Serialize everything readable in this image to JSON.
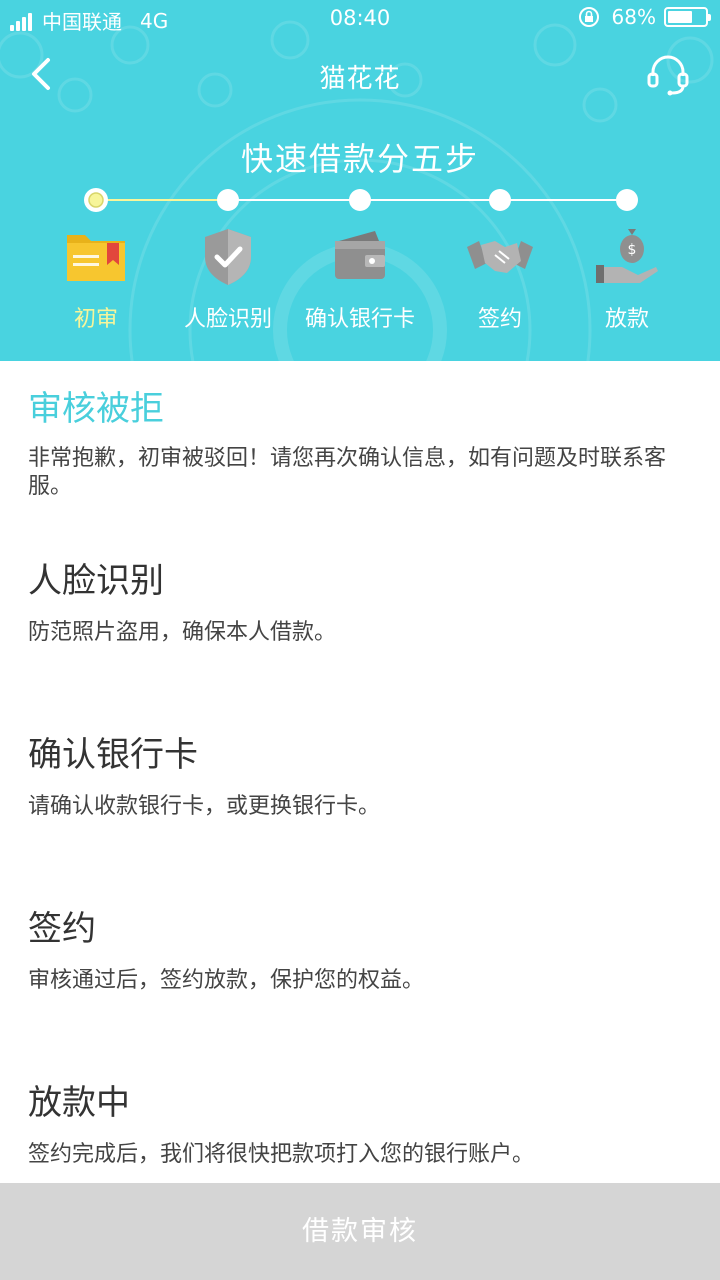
{
  "status_bar": {
    "carrier": "中国联通",
    "network": "4G",
    "time": "08:40",
    "battery": "68%",
    "battery_level": 0.68
  },
  "nav": {
    "title": "猫花花",
    "back_icon": "chevron-left-icon",
    "support_icon": "headset-icon"
  },
  "steps_header": {
    "title": "快速借款分五步",
    "current_step": 0,
    "steps": [
      {
        "label": "初审",
        "icon": "folder-icon"
      },
      {
        "label": "人脸识别",
        "icon": "shield-check-icon"
      },
      {
        "label": "确认银行卡",
        "icon": "wallet-icon"
      },
      {
        "label": "签约",
        "icon": "handshake-icon"
      },
      {
        "label": "放款",
        "icon": "money-bag-hand-icon"
      }
    ]
  },
  "sections": [
    {
      "title": "审核被拒",
      "desc": "非常抱歉，初审被驳回！请您再次确认信息，如有问题及时联系客服。"
    },
    {
      "title": "人脸识别",
      "desc": "防范照片盗用，确保本人借款。"
    },
    {
      "title": "确认银行卡",
      "desc": "请确认收款银行卡，或更换银行卡。"
    },
    {
      "title": "签约",
      "desc": "审核通过后，签约放款，保护您的权益。"
    },
    {
      "title": "放款中",
      "desc": "签约完成后，我们将很快把款项打入您的银行账户。"
    }
  ],
  "button": {
    "label": "借款审核"
  },
  "colors": {
    "header_bg": "#49d3e0",
    "active_step": "#f7f59a",
    "rejected_title": "#49cfdc",
    "button_bg": "#d5d5d5"
  }
}
